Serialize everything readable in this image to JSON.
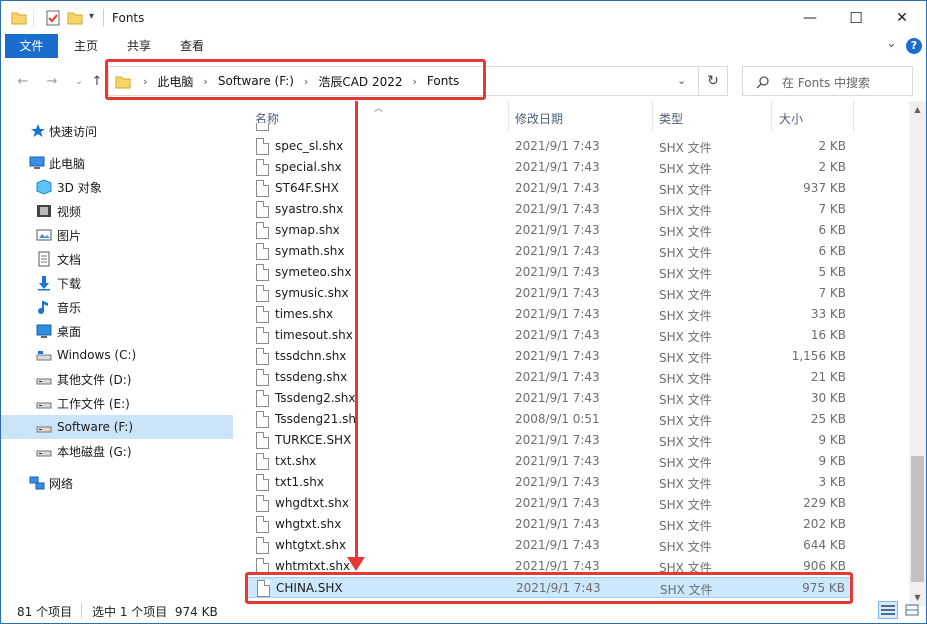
{
  "window": {
    "title": "Fonts",
    "controls": {
      "minimize": "—",
      "maximize": "☐",
      "close": "✕"
    }
  },
  "ribbon": {
    "tabs": [
      "文件",
      "主页",
      "共享",
      "查看"
    ],
    "collapse_glyph": "⌄",
    "help_glyph": "?"
  },
  "nav": {
    "back": "←",
    "forward": "→",
    "recent": "⌄",
    "up": "↑",
    "refresh": "↻"
  },
  "address": {
    "crumbs": [
      "此电脑",
      "Software (F:)",
      "浩辰CAD 2022",
      "Fonts"
    ],
    "separator": "›",
    "dropdown": "⌄"
  },
  "search": {
    "placeholder": "在 Fonts 中搜索"
  },
  "sidebar": {
    "items": [
      {
        "label": "快速访问",
        "icon": "star-icon"
      },
      {
        "label": "此电脑",
        "icon": "computer-icon"
      },
      {
        "label": "3D 对象",
        "icon": "3d-objects-icon"
      },
      {
        "label": "视频",
        "icon": "video-icon"
      },
      {
        "label": "图片",
        "icon": "pictures-icon"
      },
      {
        "label": "文档",
        "icon": "documents-icon"
      },
      {
        "label": "下载",
        "icon": "downloads-icon"
      },
      {
        "label": "音乐",
        "icon": "music-icon"
      },
      {
        "label": "桌面",
        "icon": "desktop-icon"
      },
      {
        "label": "Windows (C:)",
        "icon": "drive-c-icon"
      },
      {
        "label": "其他文件 (D:)",
        "icon": "drive-icon"
      },
      {
        "label": "工作文件 (E:)",
        "icon": "drive-icon"
      },
      {
        "label": "Software (F:)",
        "icon": "drive-icon"
      },
      {
        "label": "本地磁盘 (G:)",
        "icon": "drive-icon"
      },
      {
        "label": "网络",
        "icon": "network-icon"
      }
    ],
    "selected": "Software (F:)"
  },
  "columns": [
    "名称",
    "修改日期",
    "类型",
    "大小"
  ],
  "files": [
    {
      "name": "spec_sl.shx",
      "date": "2021/9/1 7:43",
      "type": "SHX 文件",
      "size": "2 KB"
    },
    {
      "name": "special.shx",
      "date": "2021/9/1 7:43",
      "type": "SHX 文件",
      "size": "2 KB"
    },
    {
      "name": "ST64F.SHX",
      "date": "2021/9/1 7:43",
      "type": "SHX 文件",
      "size": "937 KB"
    },
    {
      "name": "syastro.shx",
      "date": "2021/9/1 7:43",
      "type": "SHX 文件",
      "size": "7 KB"
    },
    {
      "name": "symap.shx",
      "date": "2021/9/1 7:43",
      "type": "SHX 文件",
      "size": "6 KB"
    },
    {
      "name": "symath.shx",
      "date": "2021/9/1 7:43",
      "type": "SHX 文件",
      "size": "6 KB"
    },
    {
      "name": "symeteo.shx",
      "date": "2021/9/1 7:43",
      "type": "SHX 文件",
      "size": "5 KB"
    },
    {
      "name": "symusic.shx",
      "date": "2021/9/1 7:43",
      "type": "SHX 文件",
      "size": "7 KB"
    },
    {
      "name": "times.shx",
      "date": "2021/9/1 7:43",
      "type": "SHX 文件",
      "size": "33 KB"
    },
    {
      "name": "timesout.shx",
      "date": "2021/9/1 7:43",
      "type": "SHX 文件",
      "size": "16 KB"
    },
    {
      "name": "tssdchn.shx",
      "date": "2021/9/1 7:43",
      "type": "SHX 文件",
      "size": "1,156 KB"
    },
    {
      "name": "tssdeng.shx",
      "date": "2021/9/1 7:43",
      "type": "SHX 文件",
      "size": "21 KB"
    },
    {
      "name": "Tssdeng2.shx",
      "date": "2021/9/1 7:43",
      "type": "SHX 文件",
      "size": "30 KB"
    },
    {
      "name": "Tssdeng21.shx",
      "date": "2008/9/1 0:51",
      "type": "SHX 文件",
      "size": "25 KB"
    },
    {
      "name": "TURKCE.SHX",
      "date": "2021/9/1 7:43",
      "type": "SHX 文件",
      "size": "9 KB"
    },
    {
      "name": "txt.shx",
      "date": "2021/9/1 7:43",
      "type": "SHX 文件",
      "size": "9 KB"
    },
    {
      "name": "txt1.shx",
      "date": "2021/9/1 7:43",
      "type": "SHX 文件",
      "size": "3 KB"
    },
    {
      "name": "whgdtxt.shx",
      "date": "2021/9/1 7:43",
      "type": "SHX 文件",
      "size": "229 KB"
    },
    {
      "name": "whgtxt.shx",
      "date": "2021/9/1 7:43",
      "type": "SHX 文件",
      "size": "202 KB"
    },
    {
      "name": "whtgtxt.shx",
      "date": "2021/9/1 7:43",
      "type": "SHX 文件",
      "size": "644 KB"
    },
    {
      "name": "whtmtxt.shx",
      "date": "2021/9/1 7:43",
      "type": "SHX 文件",
      "size": "906 KB"
    },
    {
      "name": "CHINA.SHX",
      "date": "2021/9/1 7:43",
      "type": "SHX 文件",
      "size": "975 KB",
      "selected": true
    }
  ],
  "status": {
    "count": "81 个项目",
    "selection": "选中 1 个项目  974 KB"
  },
  "scroll_fraction": 0.82,
  "colors": {
    "accent": "#1a6dcc",
    "highlight": "#e53935",
    "selected_row": "#cce8ff"
  }
}
